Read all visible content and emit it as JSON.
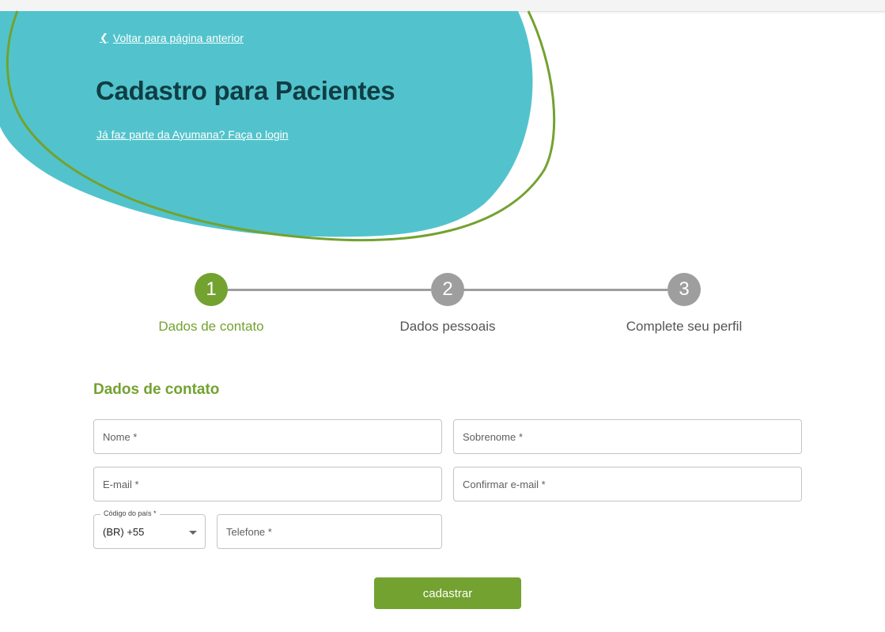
{
  "header": {
    "back_label": "Voltar para página anterior",
    "title": "Cadastro para Pacientes",
    "login_link": "Já faz parte da Ayumana? Faça o login"
  },
  "stepper": {
    "steps": [
      {
        "number": "1",
        "label": "Dados de contato",
        "active": true
      },
      {
        "number": "2",
        "label": "Dados pessoais",
        "active": false
      },
      {
        "number": "3",
        "label": "Complete seu perfil",
        "active": false
      }
    ]
  },
  "form": {
    "section_title": "Dados de contato",
    "fields": {
      "nome": {
        "placeholder": "Nome *",
        "value": ""
      },
      "sobrenome": {
        "placeholder": "Sobrenome *",
        "value": ""
      },
      "email": {
        "placeholder": "E-mail *",
        "value": ""
      },
      "confirmar_email": {
        "placeholder": "Confirmar e-mail *",
        "value": ""
      },
      "codigo_pais": {
        "label": "Código do país *",
        "value": "(BR) +55"
      },
      "telefone": {
        "placeholder": "Telefone *",
        "value": ""
      }
    },
    "submit_label": "cadastrar"
  },
  "colors": {
    "teal": "#52c3cc",
    "green": "#73a230",
    "dark_title": "#0f3d44",
    "gray_step": "#9e9e9e"
  },
  "icons": {
    "back": "chevron-left-icon",
    "select_caret": "caret-down-icon"
  }
}
